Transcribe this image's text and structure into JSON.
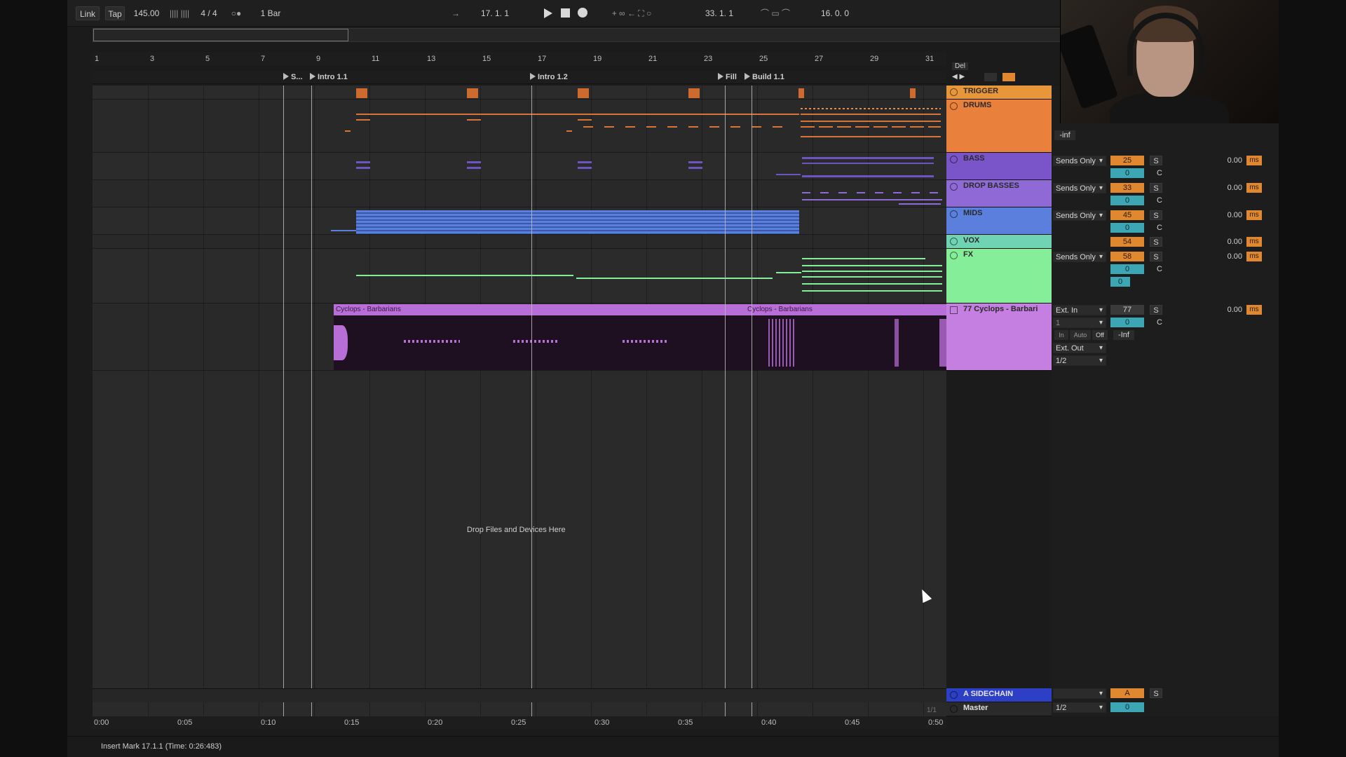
{
  "transport": {
    "link": "Link",
    "tap": "Tap",
    "tempo": "145.00",
    "signature": "4 / 4",
    "quantize": "1 Bar",
    "position": "17.   1.   1",
    "loop_start": "33.   1.   1",
    "loop_length": "16.   0.   0"
  },
  "ruler": {
    "bars": [
      "1",
      "3",
      "5",
      "7",
      "9",
      "11",
      "13",
      "15",
      "17",
      "19",
      "21",
      "23",
      "25",
      "27",
      "29",
      "31"
    ]
  },
  "locators": [
    "S...",
    "Intro 1.1",
    "Intro 1.2",
    "Fill",
    "Build 1.1"
  ],
  "del_label": "Del",
  "drop_hint": "Drop Files and Devices Here",
  "audio_clip": {
    "name_left": "Cyclops - Barbarians",
    "name_right": "Cyclops - Barbarians"
  },
  "tracks": [
    {
      "name": "TRIGGER",
      "color": "#e8963a"
    },
    {
      "name": "DRUMS",
      "color": "#e9803b",
      "mixer": {
        "dB": "-inf"
      }
    },
    {
      "name": "BASS",
      "color": "#7a55c9",
      "mixer": {
        "routing": "Sends Only",
        "volume": "25",
        "pan": "0",
        "pan_label": "C",
        "delay": "0.00",
        "unit": "ms"
      }
    },
    {
      "name": "DROP BASSES",
      "color": "#8f6ad6",
      "mixer": {
        "routing": "Sends Only",
        "volume": "33",
        "pan": "0",
        "pan_label": "C",
        "delay": "0.00",
        "unit": "ms"
      }
    },
    {
      "name": "MIDS",
      "color": "#5a7fdc",
      "mixer": {
        "routing": "Sends Only",
        "volume": "45",
        "pan": "0",
        "pan_label": "C",
        "delay": "0.00",
        "unit": "ms"
      }
    },
    {
      "name": "VOX",
      "color": "#6fd3b4",
      "mixer": {
        "volume": "54",
        "delay": "0.00",
        "unit": "ms"
      }
    },
    {
      "name": "FX",
      "color": "#84ee99",
      "mixer": {
        "routing": "Sends Only",
        "volume": "58",
        "pan": "0",
        "pan_label": "C",
        "sub": "0",
        "delay": "0.00",
        "unit": "ms"
      }
    },
    {
      "name": "77 Cyclops - Barbari",
      "color": "#c57fe0",
      "mixer": {
        "input": "Ext. In",
        "channel": "1",
        "volume": "77",
        "pan": "0",
        "pan_label": "C",
        "dB": "-Inf",
        "monitor": [
          "In",
          "Auto",
          "Off"
        ],
        "output": "Ext. Out",
        "out_channel": "1/2",
        "delay": "0.00",
        "unit": "ms"
      }
    }
  ],
  "returns": {
    "sidechain": {
      "name": "A SIDECHAIN",
      "volume": "A"
    },
    "master": {
      "name": "Master",
      "output": "1/2",
      "pan": "0"
    }
  },
  "time_ruler": [
    "0:00",
    "0:05",
    "0:10",
    "0:15",
    "0:20",
    "0:25",
    "0:30",
    "0:35",
    "0:40",
    "0:45",
    "0:50"
  ],
  "page_indicator": "1/1",
  "status_text": "Insert Mark 17.1.1 (Time: 0:26:483)",
  "colors": {
    "accent_orange": "#e0882f",
    "pan_teal": "#3ca6b5",
    "audio_clip": "#b76ed6"
  }
}
